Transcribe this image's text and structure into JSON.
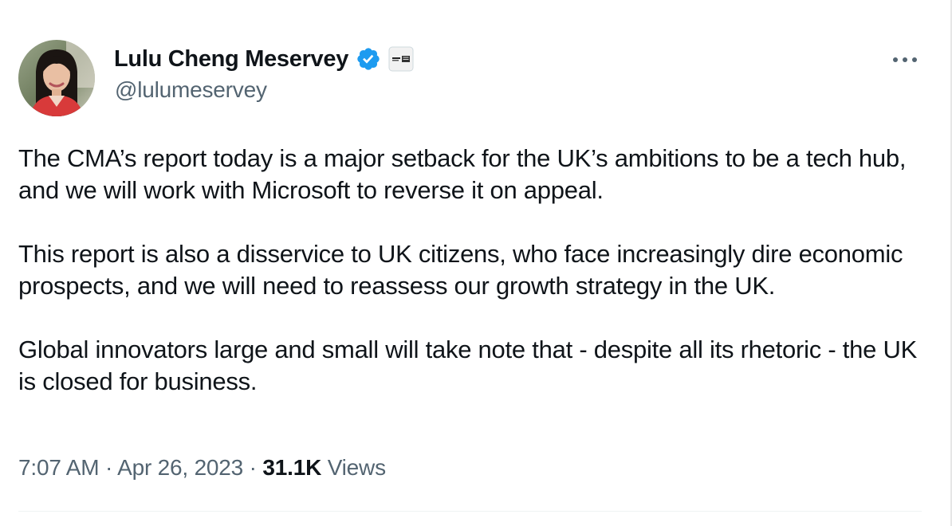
{
  "author": {
    "display_name": "Lulu Cheng Meserve",
    "display_name_full": "Lulu Cheng Meservey",
    "handle": "@lulumeservey",
    "verified": true,
    "verified_icon": "verified-badge-icon",
    "affiliate_icon": "affiliate-badge-icon"
  },
  "tweet": {
    "paragraphs": [
      "The CMA’s report today is a major setback for the UK’s ambitions to be a tech hub, and we will work with Microsoft to reverse it on appeal.",
      "This report is also a disservice to UK citizens, who face increasingly dire economic prospects, and we will need to reassess our growth strategy in the UK.",
      "Global innovators large and small will take note that - despite all its rhetoric - the UK is closed for business."
    ]
  },
  "meta": {
    "time": "7:07 AM",
    "separator": "·",
    "date": "Apr 26, 2023",
    "views_count": "31.1K",
    "views_label": "Views"
  },
  "more_icon": "more-horizontal-icon",
  "colors": {
    "text": "#0f1419",
    "secondary": "#536471",
    "verified_blue": "#1d9bf0",
    "divider": "#eff3f4"
  }
}
